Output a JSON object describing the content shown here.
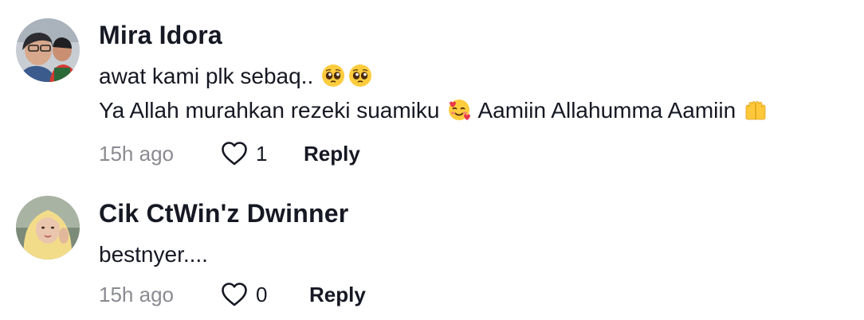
{
  "comments": [
    {
      "username": "Mira Idora",
      "lines": [
        "awat kami plk sebaq.. ",
        "Ya Allah murahkan rezeki suamiku ",
        " Aamiin Allahumma Aamiin "
      ],
      "emojis": [
        "pleading-face-emoji",
        "pleading-face-emoji",
        "smiling-face-with-hearts-emoji",
        "palms-up-together-emoji"
      ],
      "time": "15h ago",
      "likes": "1",
      "reply_label": "Reply"
    },
    {
      "username": "Cik CtWin'z Dwinner",
      "lines": [
        "bestnyer...."
      ],
      "time": "15h ago",
      "likes": "0",
      "reply_label": "Reply"
    }
  ],
  "icons": {
    "like": "heart-outline-icon"
  },
  "colors": {
    "text": "#161823",
    "secondary": "#8a8b91",
    "background": "#ffffff"
  }
}
